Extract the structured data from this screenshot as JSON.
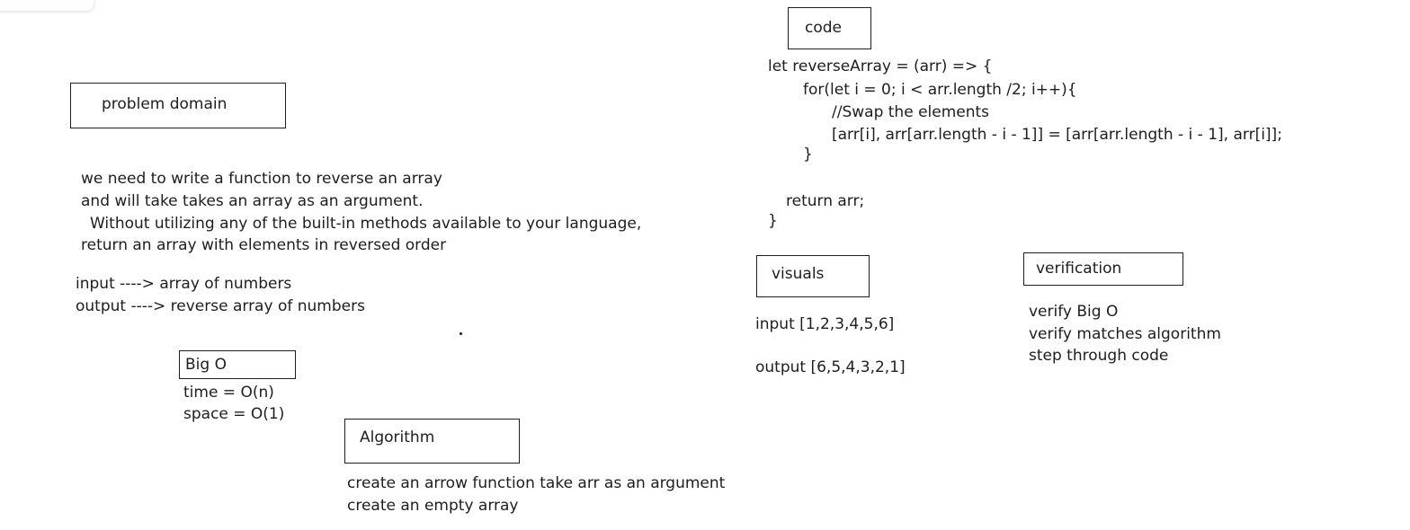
{
  "code": {
    "title": "code",
    "lines": [
      "let reverseArray = (arr) => {",
      "for(let i = 0; i < arr.length /2; i++){",
      "//Swap the elements",
      "[arr[i], arr[arr.length - i - 1]] = [arr[arr.length - i - 1], arr[i]];",
      "}",
      "return arr;",
      "}"
    ]
  },
  "problem_domain": {
    "title": "problem domain",
    "lines": [
      "we need to write a function to reverse an array",
      "and will take takes an array as an argument.",
      "Without utilizing any of the built-in methods available to your language,",
      "return an array with elements in reversed order"
    ],
    "input": "input ----> array of numbers",
    "output": "output ----> reverse array of numbers"
  },
  "big_o": {
    "title": "Big O",
    "time": "time = O(n)",
    "space": "space = O(1)"
  },
  "algorithm": {
    "title": "Algorithm",
    "lines": [
      "create an arrow function take arr as an argument",
      "create an empty array"
    ]
  },
  "visuals": {
    "title": "visuals",
    "input": "input [1,2,3,4,5,6]",
    "output": "output [6,5,4,3,2,1]"
  },
  "verification": {
    "title": "verification",
    "lines": [
      "verify Big O",
      "verify matches algorithm",
      "step through code"
    ]
  }
}
